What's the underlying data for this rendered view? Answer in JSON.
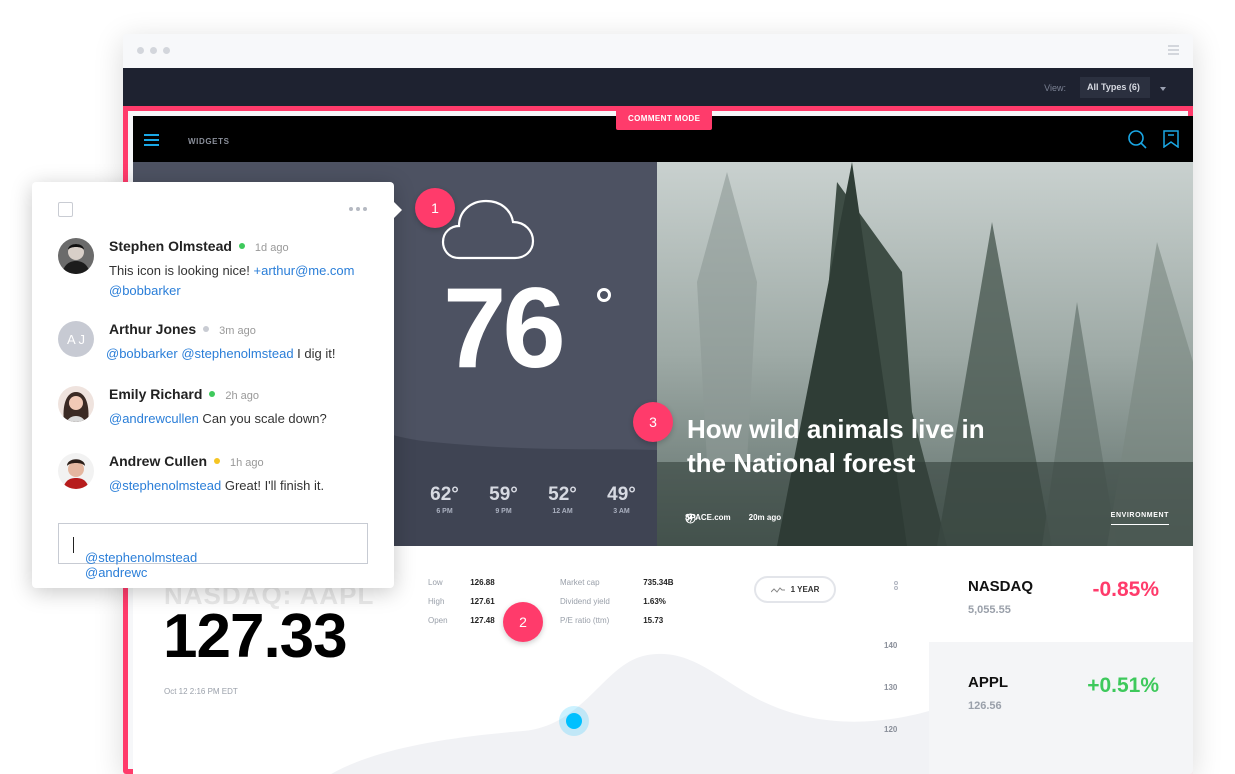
{
  "app": {
    "view_label": "View:",
    "view_value": "All Types (6)",
    "comment_mode": "COMMENT MODE",
    "nav_title": "WIDGETS"
  },
  "weather": {
    "temperature": "76",
    "forecast": [
      {
        "temp": "62°",
        "hour": "6 PM"
      },
      {
        "temp": "59°",
        "hour": "9 PM"
      },
      {
        "temp": "52°",
        "hour": "12 AM"
      },
      {
        "temp": "49°",
        "hour": "3 AM"
      }
    ]
  },
  "article": {
    "headline": "How wild animals live in the National forest",
    "source": "SPACE.com",
    "time": "20m ago",
    "category": "ENVIRONMENT"
  },
  "stock": {
    "ticker": "NASDAQ: AAPL",
    "price": "127.33",
    "date": "Oct 12 2:16 PM EDT",
    "stats_left": [
      {
        "k": "Low",
        "v": "126.88"
      },
      {
        "k": "High",
        "v": "127.61"
      },
      {
        "k": "Open",
        "v": "127.48"
      }
    ],
    "stats_right": [
      {
        "k": "Market cap",
        "v": "735.34B"
      },
      {
        "k": "Dividend yield",
        "v": "1.63%"
      },
      {
        "k": "P/E ratio (ttm)",
        "v": "15.73"
      }
    ],
    "range_button": "1 YEAR",
    "axis": [
      "140",
      "130",
      "120"
    ]
  },
  "indices": [
    {
      "name": "NASDAQ",
      "value": "5,055.55",
      "change": "-0.85%",
      "color": "#ff3b6b"
    },
    {
      "name": "APPL",
      "value": "126.56",
      "change": "+0.51%",
      "color": "#3ec95c"
    }
  ],
  "pins": [
    "1",
    "2",
    "3"
  ],
  "comments": [
    {
      "name": "Stephen Olmstead",
      "time": "1d ago",
      "status_color": "#3ec95c",
      "mention": "",
      "text": "This icon is looking nice! ",
      "mention2": "+arthur@me.com @bobbarker"
    },
    {
      "name": "Arthur Jones",
      "time": "3m ago",
      "status_color": "#c9ccd3",
      "initials": "A J",
      "mention": "@bobbarker @stephenolmstead",
      "text": " I dig it!"
    },
    {
      "name": "Emily Richard",
      "time": "2h ago",
      "status_color": "#3ec95c",
      "mention": "@andrewcullen",
      "text": " Can you scale down?"
    },
    {
      "name": "Andrew Cullen",
      "time": "1h ago",
      "status_color": "#f5c523",
      "mention": "@stephenolmstead",
      "text": " Great! I'll finish it."
    }
  ],
  "reply": {
    "value": "@stephenolmstead @andrewc"
  }
}
